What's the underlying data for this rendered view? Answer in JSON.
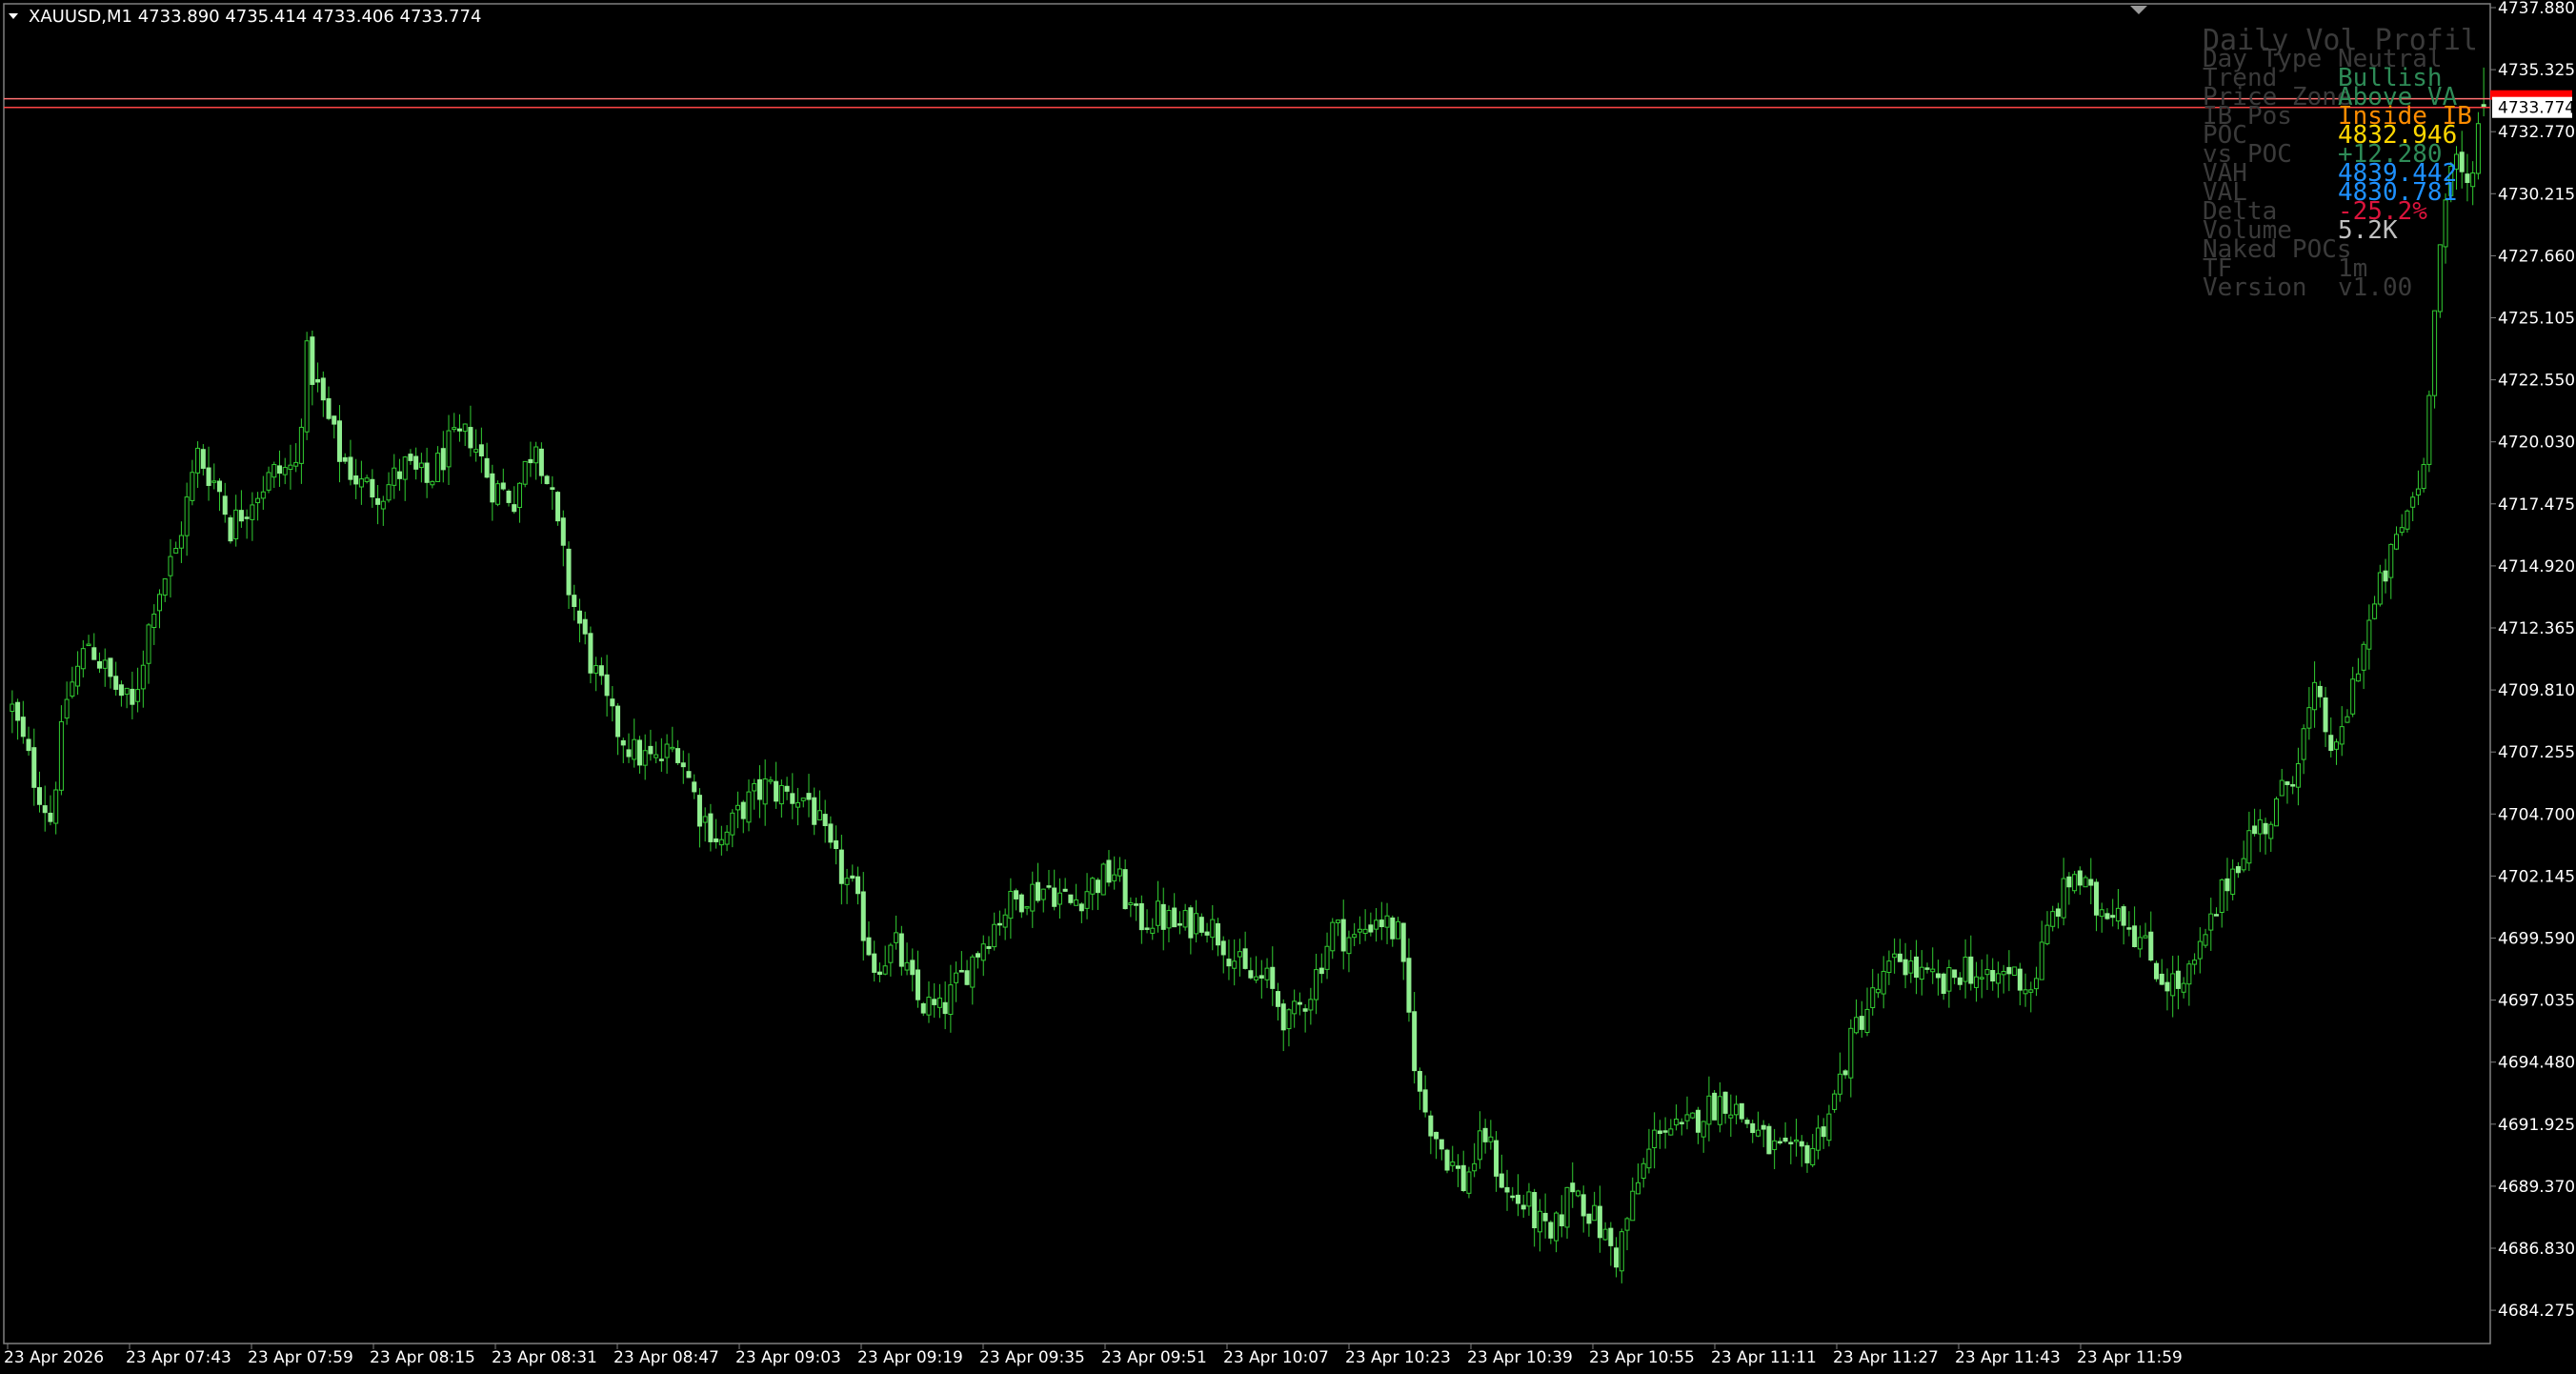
{
  "window": {
    "symbol_line": "XAUUSD,M1  4733.890 4735.414 4733.406 4733.774",
    "menu_icon": "triangle-down-icon",
    "scroll_marker_icon": "triangle-down-icon"
  },
  "colors": {
    "background": "#000000",
    "frame": "#808080",
    "text": "#FFFFFF",
    "candle_up_body": "#000000",
    "candle_up_outline": "#32CD32",
    "candle_down_body": "#90EE90",
    "candle_wick": "#32CD32",
    "bid_line": "#FF4444",
    "ask_line": "#FF8080",
    "price_tag_bg": "#FFFFFF",
    "price_tag_text": "#000000",
    "price_tag_marker": "#FF0000"
  },
  "chart_data": {
    "type": "candlestick",
    "y_axis": {
      "ticks": [
        "4737.880",
        "4735.325",
        "4732.770",
        "4730.215",
        "4727.660",
        "4725.105",
        "4722.550",
        "4720.030",
        "4717.475",
        "4714.920",
        "4712.365",
        "4709.810",
        "4707.255",
        "4704.700",
        "4702.145",
        "4699.590",
        "4697.035",
        "4694.480",
        "4691.925",
        "4689.370",
        "4686.830",
        "4684.275"
      ],
      "range": [
        4683.5,
        4737.9
      ]
    },
    "x_axis": {
      "ticks": [
        "23 Apr 2026",
        "23 Apr 07:43",
        "23 Apr 07:59",
        "23 Apr 08:15",
        "23 Apr 08:31",
        "23 Apr 08:47",
        "23 Apr 09:03",
        "23 Apr 09:19",
        "23 Apr 09:35",
        "23 Apr 09:51",
        "23 Apr 10:07",
        "23 Apr 10:23",
        "23 Apr 10:39",
        "23 Apr 10:55",
        "23 Apr 11:11",
        "23 Apr 11:27",
        "23 Apr 11:43",
        "23 Apr 11:59"
      ],
      "bars_total": 262,
      "minutes_per_label": 16
    },
    "price_path": [
      [
        0,
        4708.5
      ],
      [
        3,
        4706.0
      ],
      [
        6,
        4704.6
      ],
      [
        9,
        4711.5
      ],
      [
        12,
        4710.3
      ],
      [
        15,
        4709.0
      ],
      [
        18,
        4713.5
      ],
      [
        22,
        4717.0
      ],
      [
        26,
        4720.0
      ],
      [
        30,
        4718.0
      ],
      [
        34,
        4717.0
      ],
      [
        38,
        4719.0
      ],
      [
        42,
        4723.5
      ],
      [
        46,
        4721.0
      ],
      [
        50,
        4719.0
      ],
      [
        54,
        4718.5
      ],
      [
        58,
        4719.5
      ],
      [
        62,
        4719.0
      ],
      [
        66,
        4718.0
      ],
      [
        70,
        4717.5
      ],
      [
        74,
        4719.0
      ],
      [
        78,
        4719.5
      ],
      [
        82,
        4717.0
      ],
      [
        86,
        4714.0
      ],
      [
        90,
        4711.0
      ],
      [
        94,
        4708.5
      ],
      [
        98,
        4707.0
      ],
      [
        102,
        4706.5
      ],
      [
        106,
        4705.0
      ],
      [
        110,
        4703.0
      ],
      [
        114,
        4704.5
      ],
      [
        118,
        4705.5
      ],
      [
        122,
        4705.0
      ],
      [
        126,
        4704.0
      ],
      [
        130,
        4704.5
      ],
      [
        134,
        4703.0
      ],
      [
        138,
        4701.5
      ],
      [
        142,
        4699.5
      ],
      [
        146,
        4698.0
      ],
      [
        150,
        4697.5
      ],
      [
        154,
        4696.5
      ],
      [
        158,
        4698.0
      ],
      [
        162,
        4699.5
      ],
      [
        166,
        4700.0
      ],
      [
        170,
        4701.5
      ],
      [
        174,
        4702.0
      ],
      [
        178,
        4701.0
      ],
      [
        182,
        4701.0
      ],
      [
        186,
        4702.0
      ],
      [
        190,
        4702.5
      ],
      [
        194,
        4701.0
      ],
      [
        198,
        4700.5
      ],
      [
        202,
        4700.0
      ],
      [
        206,
        4699.0
      ],
      [
        210,
        4700.5
      ],
      [
        214,
        4700.0
      ],
      [
        218,
        4699.0
      ],
      [
        222,
        4697.5
      ],
      [
        226,
        4697.0
      ],
      [
        230,
        4695.5
      ],
      [
        234,
        4699.0
      ],
      [
        238,
        4700.5
      ],
      [
        242,
        4700.0
      ],
      [
        246,
        4691.5
      ],
      [
        250,
        4689.5
      ],
      [
        254,
        4689.0
      ],
      [
        258,
        4690.0
      ],
      [
        262,
        4688.5
      ],
      [
        266,
        4688.0
      ],
      [
        270,
        4688.5
      ],
      [
        274,
        4687.0
      ],
      [
        278,
        4688.5
      ],
      [
        282,
        4688.0
      ],
      [
        286,
        4688.0
      ],
      [
        290,
        4688.0
      ]
    ],
    "displayed_window_start_bar": 0,
    "last": {
      "open": 4733.89,
      "high": 4735.414,
      "low": 4733.406,
      "close": 4733.774
    },
    "bid_line": 4733.774,
    "ask_line": 4734.05,
    "grid": false
  },
  "info_panel": {
    "title": "Daily Vol Profil",
    "rows": [
      {
        "label": "Day Type",
        "value": "Neutral",
        "color": "#3A3A3A"
      },
      {
        "label": "Trend",
        "value": "Bullish",
        "color": "#2E8B57"
      },
      {
        "label": "Price Zone",
        "value": "Above VA",
        "color": "#2E8B57"
      },
      {
        "label": "IB Pos",
        "value": "Inside IB",
        "color": "#FF8C00"
      },
      {
        "label": "POC",
        "value": "4832.946",
        "color": "#FFD700"
      },
      {
        "label": "vs POC",
        "value": "+12.280",
        "color": "#2E8B57"
      },
      {
        "label": "VAH",
        "value": "4839.442",
        "color": "#1E90FF"
      },
      {
        "label": "VAL",
        "value": "4830.781",
        "color": "#1E90FF"
      },
      {
        "label": "Delta",
        "value": "-25.2%",
        "color": "#DC143C"
      },
      {
        "label": "Volume",
        "value": "5.2K",
        "color": "#C0C0C0"
      },
      {
        "label": "Naked POCs",
        "value": "",
        "color": "#3A3A3A"
      },
      {
        "label": "TF",
        "value": "1m",
        "color": "#3A3A3A"
      },
      {
        "label": "Version",
        "value": "v1.00",
        "color": "#3A3A3A"
      }
    ]
  }
}
